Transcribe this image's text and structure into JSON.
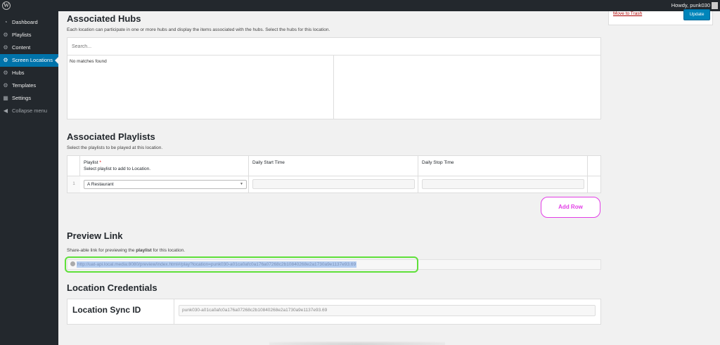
{
  "adminbar": {
    "wp_logo": "W",
    "howdy": "Howdy, punk030"
  },
  "sidebar": {
    "items": [
      {
        "label": "Dashboard",
        "icon": "dashboard-icon"
      },
      {
        "label": "Playlists",
        "icon": "gear-icon"
      },
      {
        "label": "Content",
        "icon": "gear-icon"
      },
      {
        "label": "Screen Locations",
        "icon": "gear-icon",
        "active": true
      },
      {
        "label": "Hubs",
        "icon": "gear-icon"
      },
      {
        "label": "Templates",
        "icon": "gear-icon"
      },
      {
        "label": "Settings",
        "icon": "settings-icon"
      }
    ],
    "collapse": "Collapse menu"
  },
  "publish": {
    "trash": "Move to Trash",
    "update": "Update"
  },
  "hubs": {
    "title": "Associated Hubs",
    "description": "Each location can participate in one or more hubs and display the items associated with the hubs. Select the hubs for this location.",
    "search_placeholder": "Search...",
    "empty": "No matches found"
  },
  "playlists": {
    "title": "Associated Playlists",
    "description": "Select the playlists to be played at this location.",
    "col_playlist": "Playlist",
    "required": "*",
    "col_playlist_sub": "Select playlist to add to Location.",
    "col_start": "Daily Start Time",
    "col_stop": "Daily Stop Time",
    "row_number": "1",
    "selected_playlist": "A Restaurant",
    "add_row": "Add Row"
  },
  "preview": {
    "title": "Preview Link",
    "description_pre": "Share-able link for previewing the ",
    "description_bold": "playlist",
    "description_post": " for this location.",
    "url": "http://uat-api.local.media:8080/preview/index.html#/play?location=punk030-a01ca0afc0a176a07268c2b10840268e2a1730a9e1137e93.69"
  },
  "credentials": {
    "title": "Location Credentials",
    "sync_label": "Location Sync ID",
    "sync_value": "punk030-a01ca0afc0a176a07268c2b10840268e2a1730a9e1137e93.69"
  },
  "colors": {
    "accent": "#0073aa",
    "add_row": "#e23ee6",
    "highlight": "#5fe03a"
  }
}
